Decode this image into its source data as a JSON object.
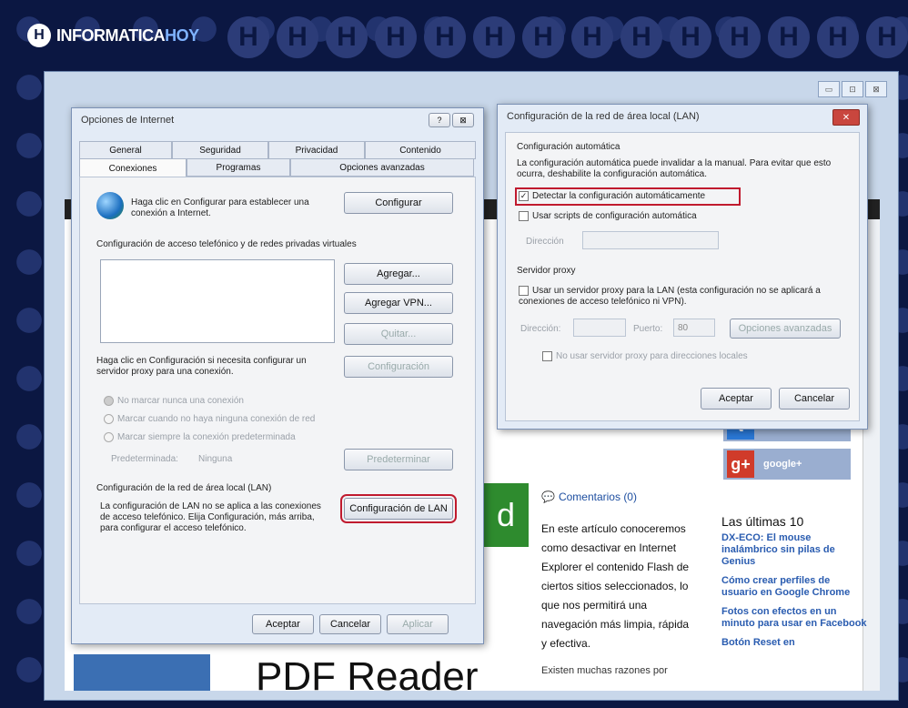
{
  "brand": {
    "logo_letter": "H",
    "name": "INFORMATICA",
    "name_accent": "HOY",
    "circle_letter": "H"
  },
  "browser": {
    "ctrl_min": "▭",
    "ctrl_max": "⊡",
    "ctrl_close": "⊠"
  },
  "page": {
    "pdf_title": "PDF Reader",
    "green_letter": "d",
    "comments": "Comentarios (0)",
    "article": "En este artículo conoceremos como desactivar en Internet Explorer el contenido Flash de ciertos sitios seleccionados, lo que nos permitirá una navegación más limpia, rápida y efectiva.",
    "article_next": "Existen muchas razones por",
    "social_twitter": "twitter",
    "social_google": "google+",
    "latest_title": "Las últimas 10",
    "latest": [
      "DX-ECO: El mouse inalámbrico sin pilas de Genius",
      "Cómo crear perfiles de usuario en Google Chrome",
      "Fotos con efectos en un minuto para usar en Facebook",
      "Botón Reset en"
    ]
  },
  "internet_options": {
    "title": "Opciones de Internet",
    "help_btn": "?",
    "close_btn": "⊠",
    "tabs_row1": [
      "General",
      "Seguridad",
      "Privacidad",
      "Contenido"
    ],
    "tabs_row2": [
      "Conexiones",
      "Programas",
      "Opciones avanzadas"
    ],
    "setup_text": "Haga clic en Configurar para establecer una conexión a Internet.",
    "setup_btn": "Configurar",
    "dialup_heading": "Configuración de acceso telefónico y de redes privadas virtuales",
    "add_btn": "Agregar...",
    "add_vpn_btn": "Agregar VPN...",
    "remove_btn": "Quitar...",
    "proxy_text": "Haga clic en Configuración si necesita configurar un servidor proxy para una conexión.",
    "settings_btn": "Configuración",
    "radio1": "No marcar nunca una conexión",
    "radio2": "Marcar cuando no haya ninguna conexión de red",
    "radio3": "Marcar siempre la conexión predeterminada",
    "default_label": "Predeterminada:",
    "default_value": "Ninguna",
    "set_default_btn": "Predeterminar",
    "lan_heading": "Configuración de la red de área local (LAN)",
    "lan_text": "La configuración de LAN no se aplica a las conexiones de acceso telefónico. Elija Configuración, más arriba, para configurar el acceso telefónico.",
    "lan_btn": "Configuración de LAN",
    "ok_btn": "Aceptar",
    "cancel_btn": "Cancelar",
    "apply_btn": "Aplicar"
  },
  "lan_dialog": {
    "title": "Configuración de la red de área local (LAN)",
    "close_btn": "✕",
    "auto_heading": "Configuración automática",
    "auto_text": "La configuración automática puede invalidar a la manual. Para evitar que esto ocurra, deshabilite la configuración automática.",
    "detect_label": "Detectar la configuración automáticamente",
    "detect_checked": true,
    "scripts_label": "Usar scripts de configuración automática",
    "address_label": "Dirección",
    "proxy_heading": "Servidor proxy",
    "proxy_label": "Usar un servidor proxy para la LAN (esta configuración no se aplicará a conexiones de acceso telefónico ni VPN).",
    "proxy_address_label": "Dirección:",
    "proxy_port_label": "Puerto:",
    "proxy_port_value": "80",
    "advanced_btn": "Opciones avanzadas",
    "bypass_label": "No usar servidor proxy para direcciones locales",
    "ok_btn": "Aceptar",
    "cancel_btn": "Cancelar"
  }
}
